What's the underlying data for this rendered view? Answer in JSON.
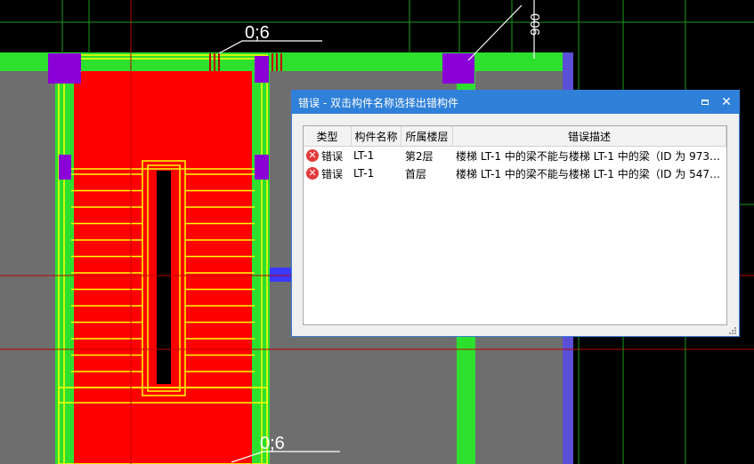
{
  "canvas": {
    "dimension_labels": {
      "top": "0;6",
      "bottom": "0;6",
      "right_vertical": "900"
    },
    "colors": {
      "background": "#000000",
      "slab_gray": "#6e6e6e",
      "wall_green": "#2ee02e",
      "stair_red": "#ff0000",
      "outline_yellow": "#ffff00",
      "column_purple": "#8a00d6",
      "beam_blue": "#5a4fd6",
      "axis_red": "#c00000"
    }
  },
  "dialog": {
    "title": "错误 - 双击构件名称选择出错构件",
    "columns": {
      "type": "类型",
      "name": "构件名称",
      "floor": "所属楼层",
      "desc": "错误描述"
    },
    "rows": [
      {
        "type": "错误",
        "name": "LT-1",
        "floor": "第2层",
        "desc": "楼梯 LT-1 中的梁不能与楼梯 LT-1 中的梁（ID 为 9737..."
      },
      {
        "type": "错误",
        "name": "LT-1",
        "floor": "首层",
        "desc": "楼梯 LT-1 中的梁不能与楼梯 LT-1 中的梁（ID 为 5470..."
      }
    ],
    "icons": {
      "maximize": "maximize-icon",
      "close": "close-icon",
      "row_status": "error-circle-icon"
    }
  }
}
